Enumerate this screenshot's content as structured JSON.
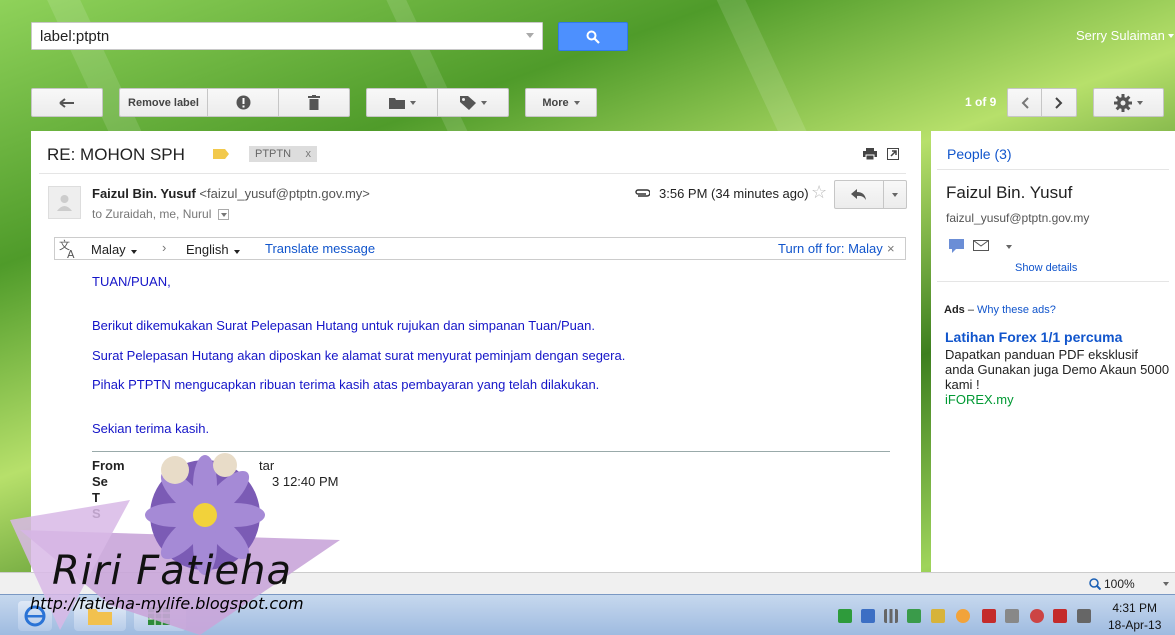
{
  "search": {
    "value": "label:ptptn"
  },
  "header": {
    "user_name": "Serry Sulaiman"
  },
  "toolbar": {
    "remove_label": "Remove label",
    "more_label": "More",
    "pager_text": "1 of 9"
  },
  "message": {
    "subject": "RE: MOHON SPH",
    "label_chip": "PTPTN",
    "label_chip_close": "x",
    "sender_name": "Faizul Bin. Yusuf",
    "sender_email": "<faizul_yusuf@ptptn.gov.my>",
    "recipients": "to Zuraidah, me, Nurul",
    "time": "3:56 PM (34 minutes ago)"
  },
  "translate": {
    "from_lang": "Malay",
    "to_lang": "English",
    "translate_link": "Translate message",
    "turn_off": "Turn off for: Malay",
    "close": "×"
  },
  "body": {
    "lines": [
      "TUAN/PUAN,",
      "Berikut dikemukakan Surat Pelepasan Hutang untuk rujukan dan simpanan Tuan/Puan.",
      "Surat Pelepasan Hutang akan diposkan ke alamat surat menyurat peminjam dengan segera.",
      "Pihak PTPTN mengucapkan ribuan terima kasih atas pembayaran yang telah dilakukan.",
      "Sekian terima kasih."
    ],
    "quoted_from": "From",
    "quoted_from_tail": "tar",
    "quoted_sent": "Se",
    "quoted_sent_tail": "3 12:40 PM",
    "quoted_to": "T",
    "quoted_s": "S"
  },
  "side": {
    "people": "People (3)",
    "person_name": "Faizul Bin. Yusuf",
    "person_email": "faizul_yusuf@ptptn.gov.my",
    "show_details": "Show details",
    "ads_label": "Ads",
    "ads_sep": " – ",
    "ads_why": "Why these ads?",
    "ad_title": "Latihan Forex 1/1 percuma",
    "ad_text": "Dapatkan panduan PDF eksklusif anda Gunakan juga Demo Akaun 5000 kami !",
    "ad_url": "iFOREX.my"
  },
  "statusbar": {
    "zoom": "100%"
  },
  "taskbar": {
    "time": "4:31 PM",
    "date": "18-Apr-13"
  },
  "watermark": {
    "name": "Riri Fatieha",
    "url": "http://fatieha-mylife.blogspot.com"
  },
  "colors": {
    "accent_blue": "#4d90fe",
    "link": "#1155cc",
    "body_text": "#1515c8",
    "ad_url": "#009933"
  }
}
